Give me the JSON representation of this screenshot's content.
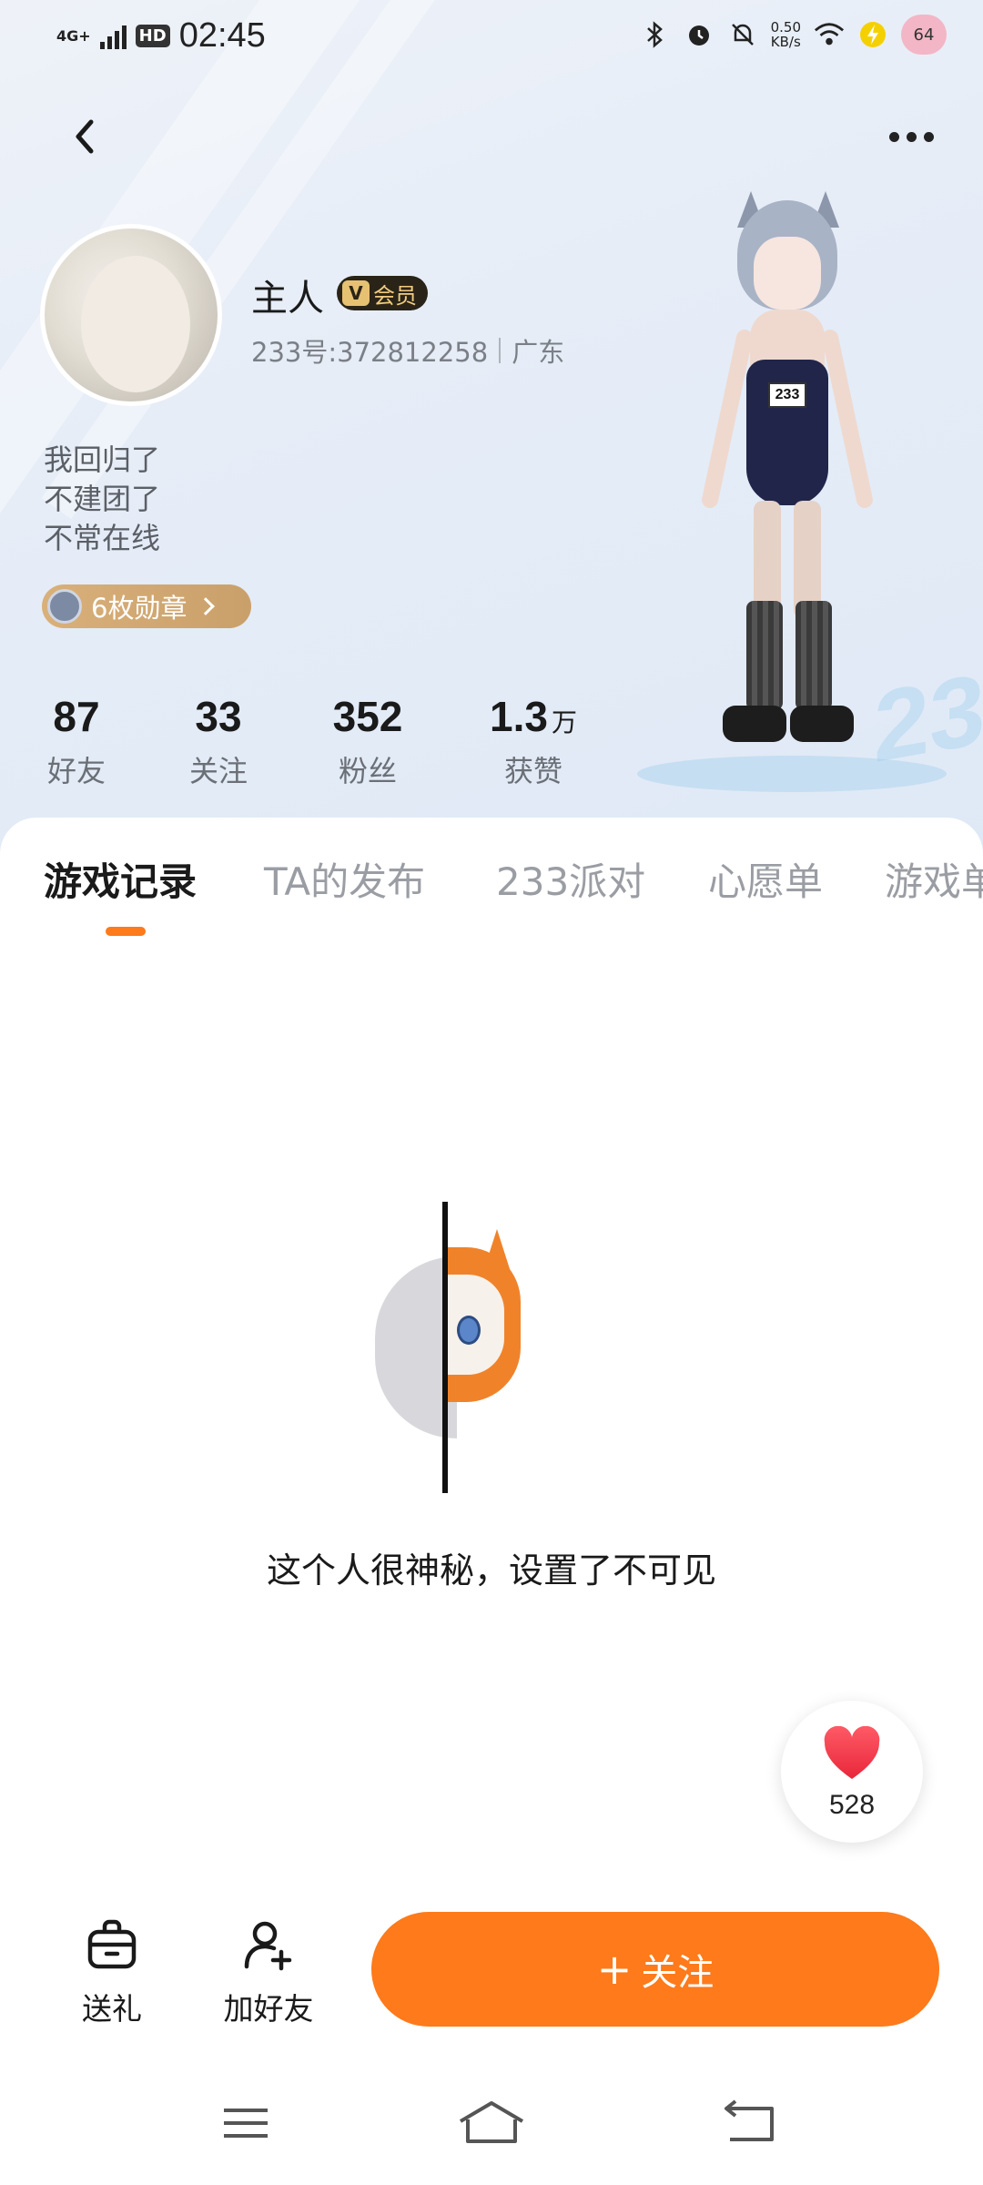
{
  "status_bar": {
    "network": "4G+",
    "hd": "HD",
    "time": "02:45",
    "speed_value": "0.50",
    "speed_unit": "KB/s",
    "battery": "64"
  },
  "profile": {
    "username": "主人",
    "vip_label": "会员",
    "vip_v": "V",
    "id_text": "233号:372812258",
    "location": "广东",
    "bio_lines": [
      "我回归了",
      "不建团了",
      "不常在线"
    ],
    "medal_label": "6枚勋章",
    "figure_tag": "233"
  },
  "stats": [
    {
      "value": "87",
      "unit": "",
      "label": "好友"
    },
    {
      "value": "33",
      "unit": "",
      "label": "关注"
    },
    {
      "value": "352",
      "unit": "",
      "label": "粉丝"
    },
    {
      "value": "1.3",
      "unit": "万",
      "label": "获赞"
    }
  ],
  "tabs": [
    {
      "label": "游戏记录",
      "active": true
    },
    {
      "label": "TA的发布",
      "active": false
    },
    {
      "label": "233派对",
      "active": false
    },
    {
      "label": "心愿单",
      "active": false
    },
    {
      "label": "游戏单",
      "active": false
    }
  ],
  "empty_state": {
    "text": "这个人很神秘，设置了不可见"
  },
  "like": {
    "count": "528"
  },
  "actions": {
    "gift_label": "送礼",
    "add_friend_label": "加好友",
    "follow_plus": "+",
    "follow_label": "关注"
  },
  "colors": {
    "accent": "#ff7a1a",
    "vip_bg": "#2a2418",
    "vip_text": "#f0cc7f",
    "medal": "#d9b07a",
    "heart": "#f23b4a"
  },
  "icons": {
    "back": "chevron-left-icon",
    "more": "more-dots-icon",
    "gift": "gift-icon",
    "add_friend": "add-user-icon",
    "heart": "heart-icon"
  }
}
